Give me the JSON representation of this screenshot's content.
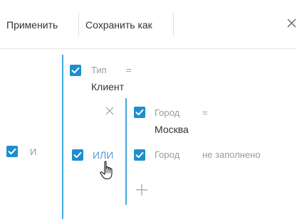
{
  "toolbar": {
    "apply_label": "Применить",
    "save_as_label": "Сохранить как"
  },
  "root_group": {
    "operator": "И"
  },
  "condition_type": {
    "field": "Тип",
    "comparison": "=",
    "value": "Клиент"
  },
  "or_group": {
    "operator": "ИЛИ"
  },
  "condition_city": {
    "field": "Город",
    "comparison": "=",
    "value": "Москва"
  },
  "condition_city_empty": {
    "field": "Город",
    "comparison": "не заполнено"
  },
  "colors": {
    "checkbox": "#1f8ece",
    "group_line": "#3fa9e3",
    "link": "#5b9bd5"
  }
}
